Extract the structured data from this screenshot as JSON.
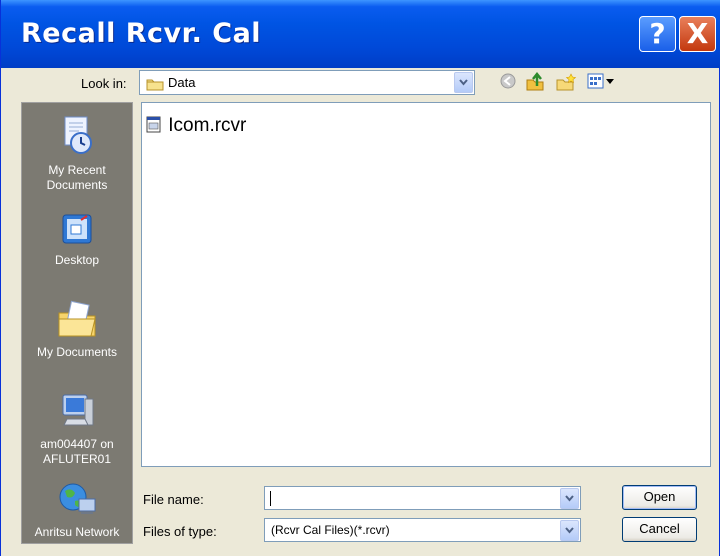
{
  "window": {
    "title": "Recall Rcvr. Cal"
  },
  "titlebar": {
    "help_label": "?",
    "close_label": "X"
  },
  "lookin": {
    "label": "Look in:",
    "value": "Data"
  },
  "toolbar": {
    "icons": [
      "back-icon",
      "up-folder-icon",
      "new-folder-icon",
      "view-menu-icon"
    ]
  },
  "places": [
    {
      "label": "My Recent Documents",
      "icon": "recent-documents-icon"
    },
    {
      "label": "Desktop",
      "icon": "desktop-icon"
    },
    {
      "label": "My Documents",
      "icon": "my-documents-icon"
    },
    {
      "label": "am004407 on AFLUTER01",
      "icon": "my-computer-icon"
    },
    {
      "label": "Anritsu Network",
      "icon": "network-icon"
    }
  ],
  "files": [
    {
      "name": "Icom.rcvr"
    }
  ],
  "filename": {
    "label": "File name:",
    "value": ""
  },
  "filetype": {
    "label": "Files of type:",
    "value": "(Rcvr Cal Files)(*.rcvr)"
  },
  "buttons": {
    "open": "Open",
    "cancel": "Cancel"
  }
}
